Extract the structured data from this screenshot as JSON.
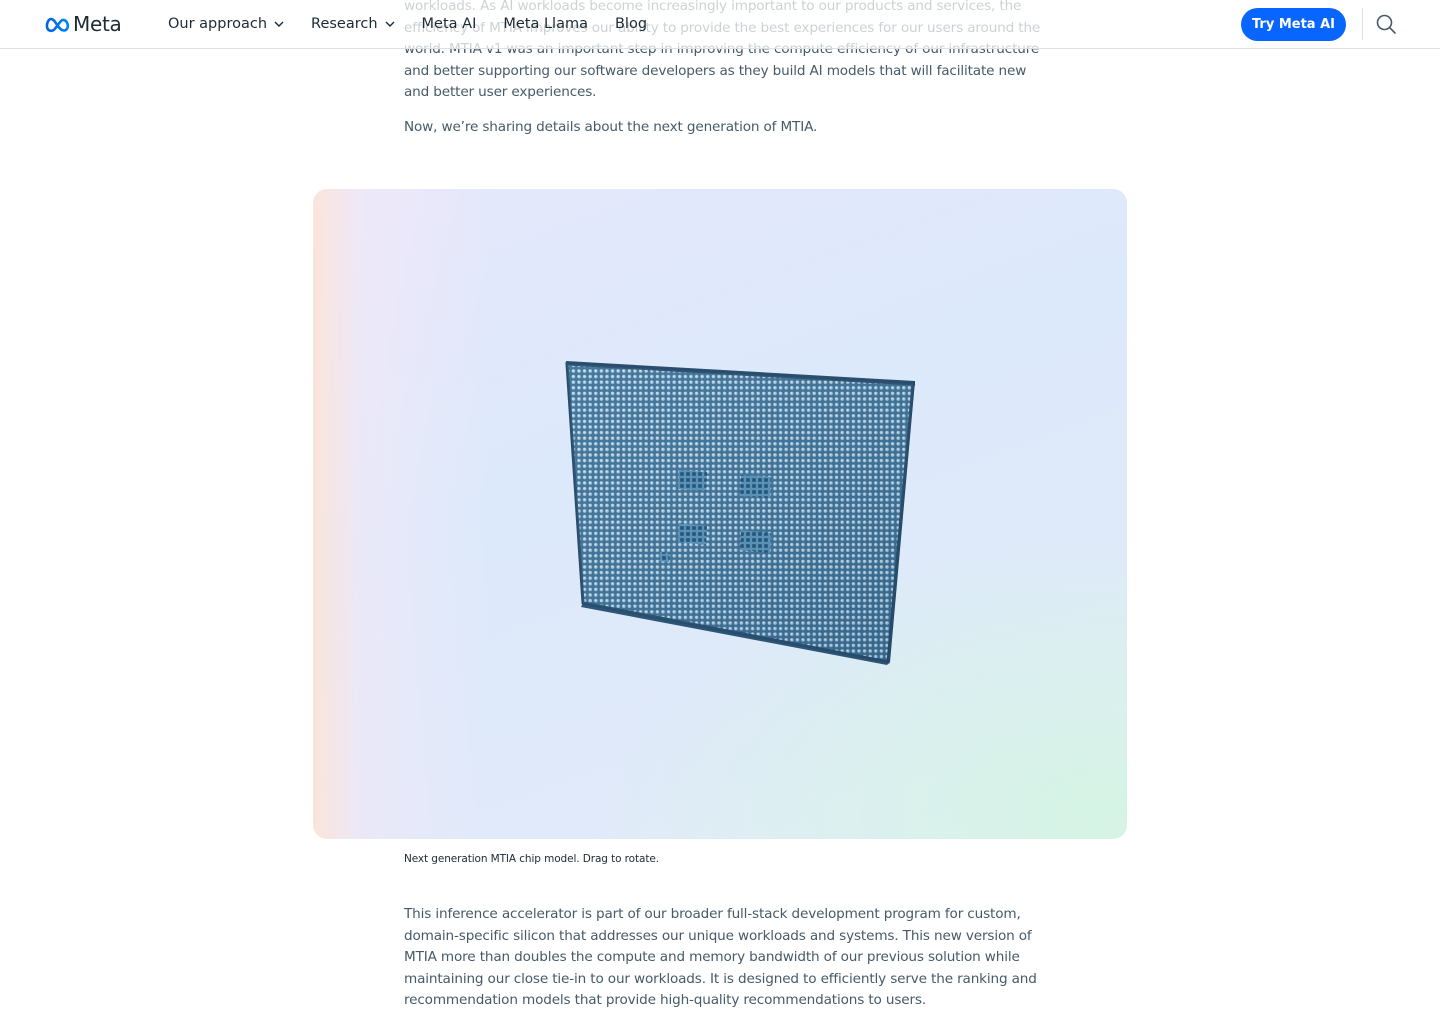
{
  "header": {
    "brand": "Meta",
    "nav": [
      {
        "label": "Our approach",
        "has_dropdown": true
      },
      {
        "label": "Research",
        "has_dropdown": true
      },
      {
        "label": "Meta AI",
        "has_dropdown": false
      },
      {
        "label": "Meta Llama",
        "has_dropdown": false
      },
      {
        "label": "Blog",
        "has_dropdown": false
      }
    ],
    "cta_label": "Try Meta AI",
    "search_icon": "search-icon"
  },
  "article": {
    "paragraph_1": "workloads. As AI workloads become increasingly important to our products and services, the efficiency of MTIA improves our ability to provide the best experiences for our users around the world. MTIA v1 was an important step in improving the compute efficiency of our infrastructure and better supporting our software developers as they build AI models that will facilitate new and better user experiences.",
    "paragraph_2": "Now, we’re sharing details about the next generation of MTIA.",
    "figure_caption": "Next generation MTIA chip model. Drag to rotate.",
    "paragraph_3": "This inference accelerator is part of our broader full-stack development program for custom, domain-specific silicon that addresses our unique workloads and systems. This new version of MTIA more than doubles the compute and memory bandwidth of our previous solution while maintaining our close tie-in to our workloads. It is designed to efficiently serve the ranking and recommendation models that provide high-quality recommendations to users."
  },
  "colors": {
    "brand_blue": "#0866ff",
    "text_primary": "#1c2b33",
    "text_body": "#465a69",
    "chip_blue": "#4a80a8"
  }
}
